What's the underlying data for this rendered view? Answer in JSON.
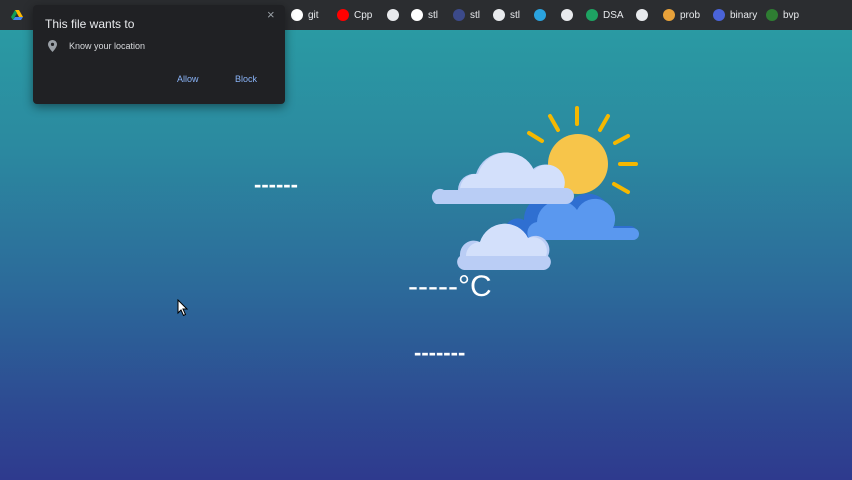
{
  "bookmarks": {
    "items": [
      {
        "label": "git",
        "icon": "github-icon",
        "color": "#ffffff"
      },
      {
        "label": "Cpp",
        "icon": "youtube-icon",
        "color": "#ff0000"
      },
      {
        "label": "",
        "icon": "g-icon",
        "color": "#e8eaed"
      },
      {
        "label": "stl",
        "icon": "github-icon",
        "color": "#ffffff"
      },
      {
        "label": "stl",
        "icon": "dot-icon",
        "color": "#3c4a8a"
      },
      {
        "label": "stl",
        "icon": "cloud-icon",
        "color": "#e8eaed"
      },
      {
        "label": "",
        "icon": "telegram-icon",
        "color": "#2aa3df"
      },
      {
        "label": "",
        "icon": "mountain-icon",
        "color": "#e8eaed"
      },
      {
        "label": "DSA",
        "icon": "plus-sheet-icon",
        "color": "#1ea362"
      },
      {
        "label": "",
        "icon": "globe-icon",
        "color": "#e8eaed"
      },
      {
        "label": "prob",
        "icon": "flame-icon",
        "color": "#e8a23a"
      },
      {
        "label": "binary",
        "icon": "binary-icon",
        "color": "#4a63d8"
      },
      {
        "label": "bvp",
        "icon": "leaf-icon",
        "color": "#2e7d32"
      }
    ]
  },
  "popup": {
    "title": "This file wants to",
    "permission": "Know your location",
    "allow_label": "Allow",
    "block_label": "Block",
    "close_label": "×"
  },
  "weather": {
    "city": "------",
    "temperature": "-----°C",
    "description": "-------"
  }
}
